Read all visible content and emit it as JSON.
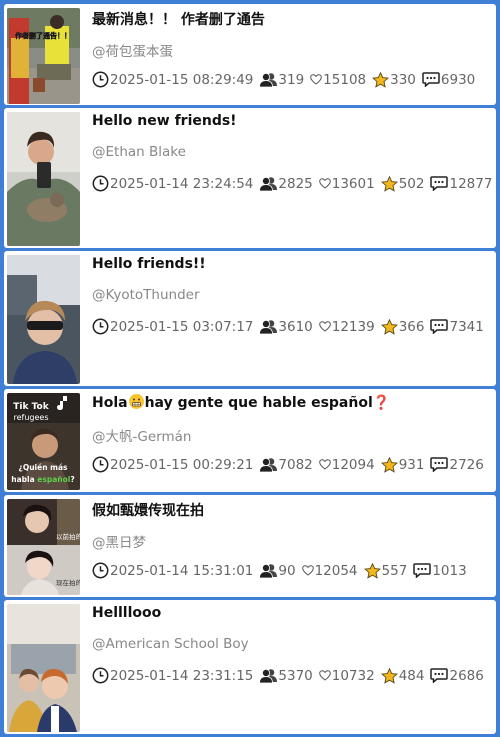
{
  "posts": [
    {
      "title": "最新消息！！ 作者删了通告",
      "author": "@荷包蛋本蛋",
      "date": "2025-01-15 08:29:49",
      "followers": "319",
      "likes": "15108",
      "stars": "330",
      "comments": "6930",
      "thumb_caption": "作者删了通告！！"
    },
    {
      "title": "Hello new friends!",
      "author": "@Ethan Blake",
      "date": "2025-01-14 23:24:54",
      "followers": "2825",
      "likes": "13601",
      "stars": "502",
      "comments": "12877"
    },
    {
      "title": "Hello friends!!",
      "author": "@KyotoThunder",
      "date": "2025-01-15 03:07:17",
      "followers": "3610",
      "likes": "12139",
      "stars": "366",
      "comments": "7341"
    },
    {
      "title_part1": "Hola",
      "title_part2": "hay gente que hable español",
      "title_part3": "❓",
      "author": "@大帆-Germán",
      "date": "2025-01-15 00:29:21",
      "followers": "7082",
      "likes": "12094",
      "stars": "931",
      "comments": "2726",
      "thumb_logo": "Tik Tok",
      "thumb_sub": "refugees",
      "thumb_line1": "¿Quién más",
      "thumb_line2a": "habla ",
      "thumb_line2b": "español",
      "thumb_line2c": "?"
    },
    {
      "title": "假如甄嬛传现在拍",
      "author": "@黑日梦",
      "date": "2025-01-14 15:31:01",
      "followers": "90",
      "likes": "12054",
      "stars": "557",
      "comments": "1013",
      "thumb_text1": "以前拍的",
      "thumb_text2": "现在拍的"
    },
    {
      "title": "Hellllooo",
      "author": "@American School Boy",
      "date": "2025-01-14 23:31:15",
      "followers": "5370",
      "likes": "10732",
      "stars": "484",
      "comments": "2686"
    }
  ],
  "icons": [
    "clock-icon",
    "followers-icon",
    "heart-icon",
    "star-icon",
    "comment-icon"
  ],
  "colors": {
    "background": "#3f7fd6",
    "star": "#f2b71c",
    "card": "#ffffff"
  }
}
